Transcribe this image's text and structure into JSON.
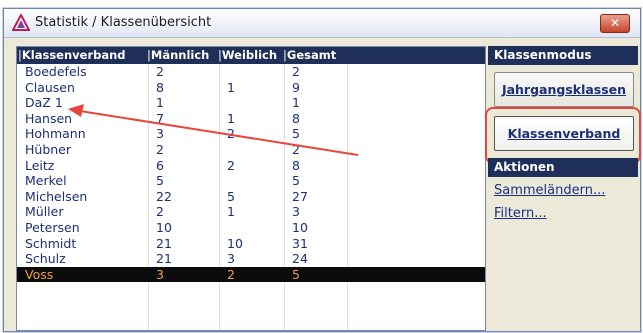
{
  "window": {
    "title": "Statistik / Klassenübersicht",
    "close_label": "✕"
  },
  "grid": {
    "columns": [
      "Klassenverband",
      "Männlich",
      "Weiblich",
      "Gesamt"
    ],
    "rows": [
      {
        "name": "Boedefels",
        "m": "2",
        "w": "",
        "g": "2",
        "selected": false
      },
      {
        "name": "Clausen",
        "m": "8",
        "w": "1",
        "g": "9",
        "selected": false
      },
      {
        "name": "DaZ 1",
        "m": "1",
        "w": "",
        "g": "1",
        "selected": false
      },
      {
        "name": "Hansen",
        "m": "7",
        "w": "1",
        "g": "8",
        "selected": false
      },
      {
        "name": "Hohmann",
        "m": "3",
        "w": "2",
        "g": "5",
        "selected": false
      },
      {
        "name": "Hübner",
        "m": "2",
        "w": "",
        "g": "2",
        "selected": false
      },
      {
        "name": "Leitz",
        "m": "6",
        "w": "2",
        "g": "8",
        "selected": false
      },
      {
        "name": "Merkel",
        "m": "5",
        "w": "",
        "g": "5",
        "selected": false
      },
      {
        "name": "Michelsen",
        "m": "22",
        "w": "5",
        "g": "27",
        "selected": false
      },
      {
        "name": "Müller",
        "m": "2",
        "w": "1",
        "g": "3",
        "selected": false
      },
      {
        "name": "Petersen",
        "m": "10",
        "w": "",
        "g": "10",
        "selected": false
      },
      {
        "name": "Schmidt",
        "m": "21",
        "w": "10",
        "g": "31",
        "selected": false
      },
      {
        "name": "Schulz",
        "m": "21",
        "w": "3",
        "g": "24",
        "selected": false
      },
      {
        "name": "Voss",
        "m": "3",
        "w": "2",
        "g": "5",
        "selected": true
      }
    ]
  },
  "panel": {
    "mode_header": "Klassenmodus",
    "btn_jahrgang": "Jahrgangsklassen",
    "btn_klassenverband": "Klassenverband",
    "actions_header": "Aktionen",
    "link_sammel": "Sammeländern...",
    "link_filter": "Filtern..."
  },
  "colors": {
    "header_bg": "#1e2f5a",
    "annotation_red": "#e8463a",
    "selection_bg": "#0b0b0b",
    "selection_fg": "#f0a040"
  }
}
